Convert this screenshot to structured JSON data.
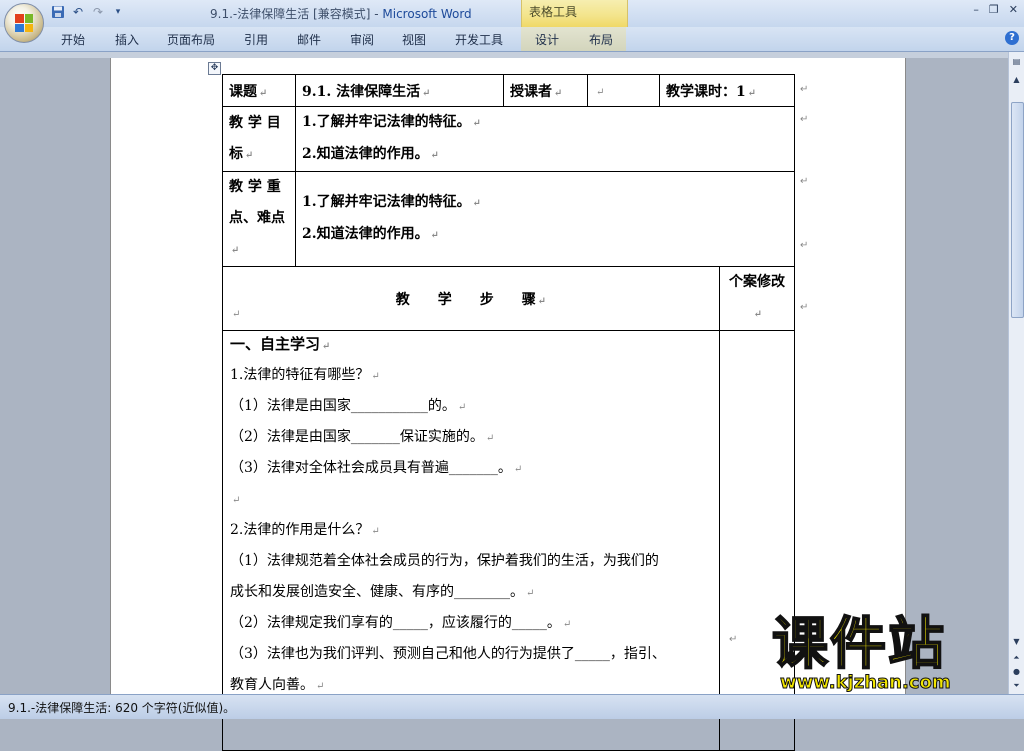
{
  "window": {
    "title": "9.1.-法律保障生活 [兼容模式]",
    "title_sep": " - ",
    "app_name": "Microsoft Word",
    "context_tab_group": "表格工具",
    "controls": {
      "minimize": "–",
      "restore": "❐",
      "close": "✕"
    }
  },
  "quick_access": {
    "save_icon": "save-icon",
    "undo_icon": "undo-icon",
    "redo_icon": "redo-icon",
    "customize_icon": "customize-icon"
  },
  "ribbon": {
    "tabs": [
      "开始",
      "插入",
      "页面布局",
      "引用",
      "邮件",
      "审阅",
      "视图",
      "开发工具",
      "设计",
      "布局"
    ],
    "help": "?"
  },
  "table": {
    "topic_label": "课题",
    "topic_value": "9.1. 法律保障生活",
    "teacher_label": "授课者",
    "hours_label": "教学课时：1",
    "goal_label": "教 学 目 标",
    "goals": [
      "1.了解并牢记法律的特征。",
      "2.知道法律的作用。"
    ],
    "key_label": "教 学 重 点、难点",
    "keys": [
      "1.了解并牢记法律的特征。",
      "2.知道法律的作用。"
    ],
    "steps_header": "教　　学　　步　　骤",
    "revision_header": "个案修改"
  },
  "content": {
    "section1": "一、自主学习",
    "q1": "1.法律的特征有哪些？",
    "q1_a": "（1）法律是由国家___________的。",
    "q1_b": "（2）法律是由国家_______保证实施的。",
    "q1_c": "（3）法律对全体社会成员具有普遍_______。",
    "q2": "2.法律的作用是什么？",
    "q2_a1": "（1）法律规范着全体社会成员的行为，保护着我们的生活，为我们的",
    "q2_a2": "成长和发展创造安全、健康、有序的________。",
    "q2_b": "（2）法律规定我们享有的_____，应该履行的_____。",
    "q2_c1": "（3）法律也为我们评判、预测自己和他人的行为提供了_____，指引、",
    "q2_c2": "教育人向善。"
  },
  "status": {
    "text": "9.1.-法律保障生活: 620 个字符(近似值)。"
  },
  "watermark": {
    "big": "课件站",
    "url": "www.kjzhan.com"
  },
  "colors": {
    "title_app": "#1d4a9a",
    "context_tab": "#f3e48a",
    "watermark": "#f2e600"
  }
}
